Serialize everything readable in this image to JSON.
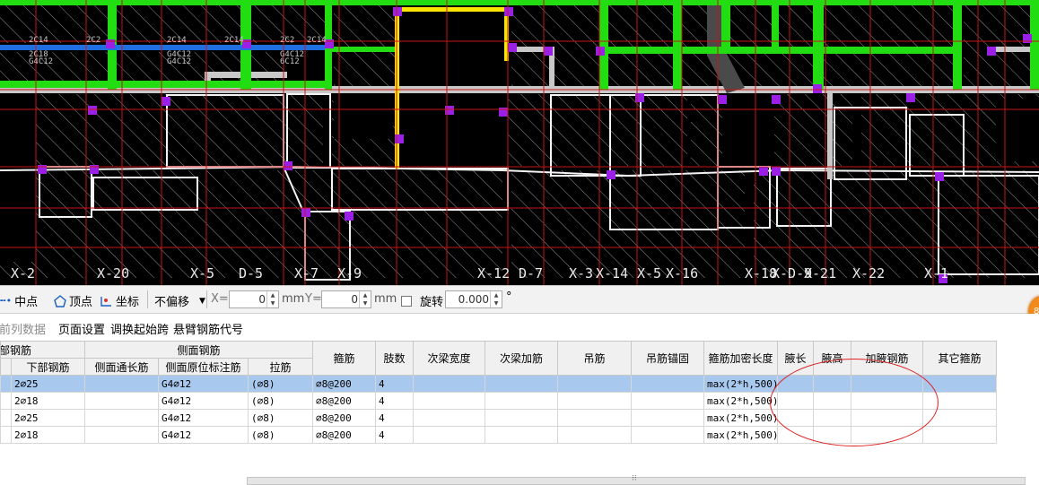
{
  "drawing": {
    "annotation_texts": [
      "2C14",
      "2C2",
      "2C14",
      "2C14",
      "2C2",
      "2C14",
      "2C18",
      "G4C12",
      "G4C12",
      "G4C12",
      "G4C12",
      "6C12"
    ],
    "axis_labels": [
      "X-2",
      "X-20",
      "X-5",
      "D-5",
      "X-7",
      "X-9",
      "X-12",
      "D-7",
      "X-3",
      "X-14",
      "X-5",
      "X-16",
      "X-18",
      "X-D-9",
      "X-21",
      "X-22",
      "X-1"
    ]
  },
  "toolbar": {
    "midpoint_label": "中点",
    "vertex_label": "顶点",
    "coord_label": "坐标",
    "offset_value": "不偏移",
    "x_label": "X=",
    "x_value": "0",
    "x_unit": "mm",
    "y_label": "Y=",
    "y_value": "0",
    "y_unit": "mm",
    "rotate_label": "旋转",
    "rotate_value": "0.000",
    "degree_symbol": "°"
  },
  "menu": {
    "items": [
      "当前列数据",
      "页面设置",
      "调换起始跨",
      "悬臂钢筋代号"
    ]
  },
  "table": {
    "group_headers": [
      "底部钢筋",
      "侧面钢筋"
    ],
    "headers": [
      "下部钢筋",
      "侧面通长筋",
      "侧面原位标注筋",
      "拉筋",
      "箍筋",
      "肢数",
      "次梁宽度",
      "次梁加筋",
      "吊筋",
      "吊筋锚固",
      "箍筋加密长度",
      "腋长",
      "腋高",
      "加腋钢筋",
      "其它箍筋"
    ],
    "rows": [
      [
        "2⌀25",
        "",
        "G4⌀12",
        "(⌀8)",
        "⌀8@200",
        "4",
        "",
        "",
        "",
        "",
        "max(2*h,500)",
        "",
        "",
        "",
        ""
      ],
      [
        "2⌀18",
        "",
        "G4⌀12",
        "(⌀8)",
        "⌀8@200",
        "4",
        "",
        "",
        "",
        "",
        "max(2*h,500)",
        "",
        "",
        "",
        ""
      ],
      [
        "2⌀25",
        "",
        "G4⌀12",
        "(⌀8)",
        "⌀8@200",
        "4",
        "",
        "",
        "",
        "",
        "max(2*h,500)",
        "",
        "",
        "",
        ""
      ],
      [
        "2⌀18",
        "",
        "G4⌀12",
        "(⌀8)",
        "⌀8@200",
        "4",
        "",
        "",
        "",
        "",
        "max(2*h,500)",
        "",
        "",
        "",
        ""
      ]
    ],
    "selected_row": 0
  },
  "colors": {
    "canvas_bg": "#000000",
    "green_beam": "#22dd11",
    "blue_beam": "#1f6fe0",
    "yellow_beam": "#ffe600",
    "red_grid": "#c81414",
    "purple_column": "#9b20e6",
    "selection": "#a8c8ee",
    "annotation_circle": "#e02020",
    "floating_button": "#f08a1c"
  }
}
